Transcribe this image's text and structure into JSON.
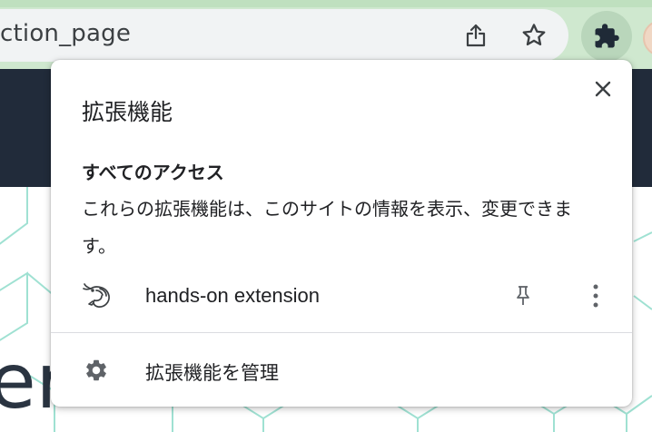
{
  "browser": {
    "url_fragment": "ction_page"
  },
  "popup": {
    "title": "拡張機能",
    "section_heading": "すべてのアクセス",
    "section_description": "これらの拡張機能は、このサイトの情報を表示、変更できます。",
    "extensions": [
      {
        "name": "hands-on extension",
        "icon": "shrimp-icon"
      }
    ],
    "manage_label": "拡張機能を管理"
  },
  "page": {
    "big_text": "er"
  },
  "colors": {
    "toolbar_bg": "#cfe8cf",
    "page_header_bg": "#212b3a",
    "pattern_stroke": "#7fd3c0",
    "text": "#202124"
  }
}
